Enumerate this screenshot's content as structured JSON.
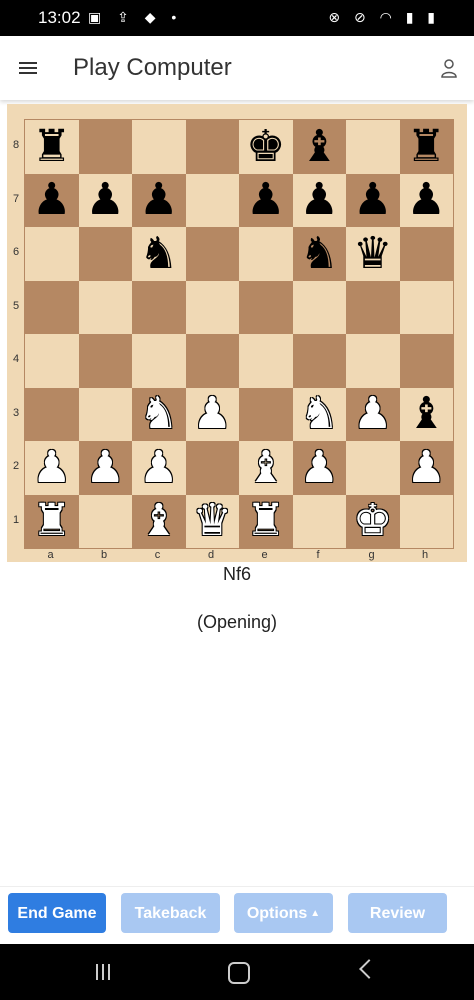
{
  "status_bar": {
    "time": "13:02",
    "left_icons": "▣ ⇪ ◆ •",
    "right_icons": "⊗ ⊘ ◠ ▮ ▮"
  },
  "app_bar": {
    "title": "Play Computer"
  },
  "board": {
    "files": [
      "a",
      "b",
      "c",
      "d",
      "e",
      "f",
      "g",
      "h"
    ],
    "ranks": [
      "8",
      "7",
      "6",
      "5",
      "4",
      "3",
      "2",
      "1"
    ],
    "position": [
      [
        "br",
        "",
        "",
        "",
        "bk",
        "bb",
        "",
        "br"
      ],
      [
        "bp",
        "bp",
        "bp",
        "",
        "bp",
        "bp",
        "bp",
        "bp"
      ],
      [
        "",
        "",
        "bn",
        "",
        "",
        "bn",
        "bq",
        ""
      ],
      [
        "",
        "",
        "",
        "",
        "",
        "",
        "",
        ""
      ],
      [
        "",
        "",
        "",
        "",
        "",
        "",
        "",
        ""
      ],
      [
        "",
        "",
        "wn",
        "wp",
        "",
        "wn",
        "wp",
        "bb"
      ],
      [
        "wp",
        "wp",
        "wp",
        "",
        "wb",
        "wp",
        "",
        "wp"
      ],
      [
        "wr",
        "",
        "wb",
        "wq",
        "wr",
        "",
        "wk",
        ""
      ]
    ],
    "colors": {
      "light": "#f0d9b5",
      "dark": "#b58863"
    }
  },
  "move": {
    "text": "Nf6"
  },
  "phase": {
    "text": "(Opening)"
  },
  "buttons": {
    "end_game": "End Game",
    "takeback": "Takeback",
    "options": "Options",
    "review": "Review"
  }
}
